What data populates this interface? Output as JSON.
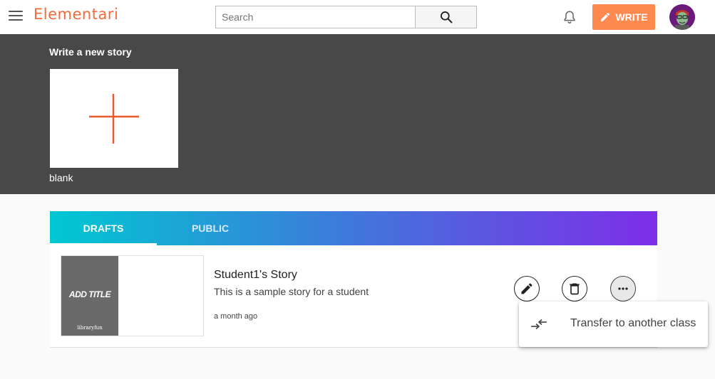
{
  "header": {
    "brand": "Elementari",
    "search_placeholder": "Search",
    "write_label": "WRITE"
  },
  "template_section": {
    "title": "Write a new story",
    "templates": [
      {
        "label": "blank"
      }
    ]
  },
  "tabs": [
    {
      "label": "DRAFTS",
      "active": true
    },
    {
      "label": "PUBLIC",
      "active": false
    }
  ],
  "stories": [
    {
      "cover_title": "ADD TITLE",
      "cover_brand": "libraryfun",
      "title": "Student1's Story",
      "description": "This is a sample story for a student",
      "time": "a month ago"
    }
  ],
  "popup_menu": {
    "items": [
      {
        "label": "Transfer to another class",
        "icon": "transfer-icon"
      }
    ]
  },
  "colors": {
    "brand": "#f26b3a",
    "write_button": "#ff8a50",
    "dark_band": "#484848",
    "tab_gradient_start": "#00c8d2",
    "tab_gradient_end": "#7e2ee8",
    "plus_stroke": "#ee5a2c"
  }
}
